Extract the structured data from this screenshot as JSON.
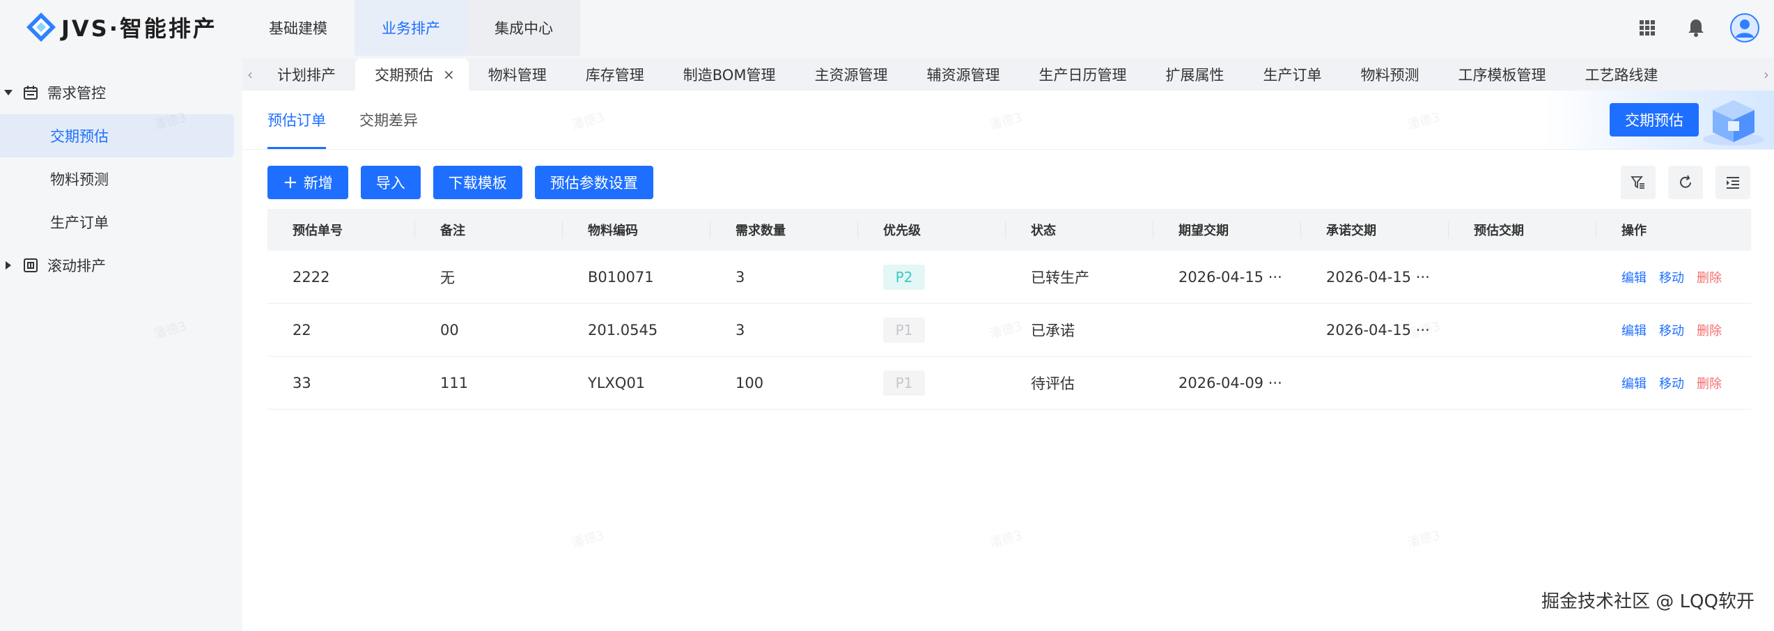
{
  "app": {
    "logo_text": "JVS·智能排产"
  },
  "top_nav": [
    {
      "label": "基础建模"
    },
    {
      "label": "业务排产"
    },
    {
      "label": "集成中心"
    }
  ],
  "sidebar": {
    "groups": [
      {
        "label": "需求管控",
        "expanded": true,
        "items": [
          {
            "label": "交期预估",
            "active": true
          },
          {
            "label": "物料预测"
          },
          {
            "label": "生产订单"
          }
        ]
      },
      {
        "label": "滚动排产",
        "expanded": false
      }
    ]
  },
  "page_tabs": [
    {
      "label": "计划排产"
    },
    {
      "label": "交期预估",
      "active": true,
      "close": "×"
    },
    {
      "label": "物料管理"
    },
    {
      "label": "库存管理"
    },
    {
      "label": "制造BOM管理"
    },
    {
      "label": "主资源管理"
    },
    {
      "label": "辅资源管理"
    },
    {
      "label": "生产日历管理"
    },
    {
      "label": "扩展属性"
    },
    {
      "label": "生产订单"
    },
    {
      "label": "物料预测"
    },
    {
      "label": "工序模板管理"
    },
    {
      "label": "工艺路线建"
    }
  ],
  "page_tab_arrows": {
    "left": "‹",
    "right": "›"
  },
  "sub_tabs": [
    {
      "label": "预估订单",
      "active": true
    },
    {
      "label": "交期差异"
    }
  ],
  "banner": {
    "button_label": "交期预估"
  },
  "toolbar": {
    "add_plus": "+",
    "add_label": "新增",
    "import_label": "导入",
    "download_label": "下载模板",
    "settings_label": "预估参数设置"
  },
  "table": {
    "headers": [
      "预估单号",
      "备注",
      "物料编码",
      "需求数量",
      "优先级",
      "状态",
      "期望交期",
      "承诺交期",
      "预估交期",
      "操作"
    ],
    "rows": [
      {
        "id": "2222",
        "note": "无",
        "code": "B010071",
        "qty": "3",
        "priority": "P2",
        "status": "已转生产",
        "expected": "2026-04-15 ···",
        "promised": "2026-04-15 ···",
        "estimated": ""
      },
      {
        "id": "22",
        "note": "00",
        "code": "201.0545",
        "qty": "3",
        "priority": "P1",
        "status": "已承诺",
        "expected": "",
        "promised": "2026-04-15 ···",
        "estimated": ""
      },
      {
        "id": "33",
        "note": "111",
        "code": "YLXQ01",
        "qty": "100",
        "priority": "P1",
        "status": "待评估",
        "expected": "2026-04-09 ···",
        "promised": "",
        "estimated": ""
      }
    ],
    "ops": {
      "edit": "编辑",
      "move": "移动",
      "delete": "删除"
    }
  },
  "watermark_text": "潘德3",
  "footer_text": "掘金技术社区 @ LQQ软开",
  "colors": {
    "primary": "#1e6fff",
    "danger": "#f56c6c",
    "tag_p2_bg": "#e2f7f6",
    "tag_p2_fg": "#3cc8c2"
  }
}
